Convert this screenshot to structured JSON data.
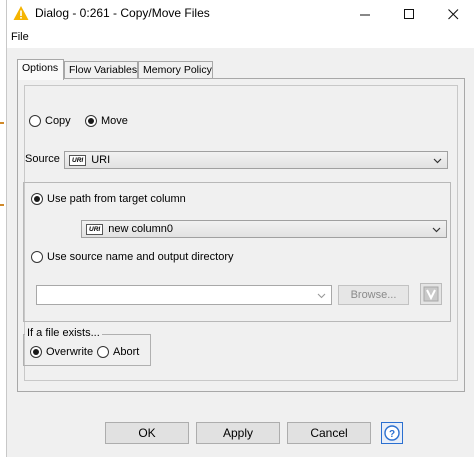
{
  "window": {
    "title": "Dialog - 0:261 - Copy/Move Files"
  },
  "menu": {
    "file_label": "File"
  },
  "tabs": [
    {
      "label": "Options",
      "active": true
    },
    {
      "label": "Flow Variables",
      "active": false
    },
    {
      "label": "Memory Policy",
      "active": false
    }
  ],
  "operation": {
    "copy_label": "Copy",
    "move_label": "Move",
    "selected": "Move"
  },
  "source": {
    "label": "Source",
    "badge": "URI",
    "value": "URI"
  },
  "target": {
    "use_path_label": "Use path from target column",
    "column_badge": "URI",
    "column_value": "new column0",
    "use_source_name_label": "Use source name and output directory",
    "selected": "Use path from target column",
    "directory_value": "",
    "browse_label": "Browse...",
    "variable_icon": "flow-variable-icon"
  },
  "if_exists": {
    "legend": "If a file exists...",
    "overwrite_label": "Overwrite",
    "abort_label": "Abort",
    "selected": "Overwrite"
  },
  "buttons": {
    "ok": "OK",
    "apply": "Apply",
    "cancel": "Cancel",
    "help_icon": "help-icon"
  },
  "colors": {
    "window_bg": "#f0f0f0",
    "accent": "#2a6fd0",
    "warning_icon": "#f5b400"
  }
}
